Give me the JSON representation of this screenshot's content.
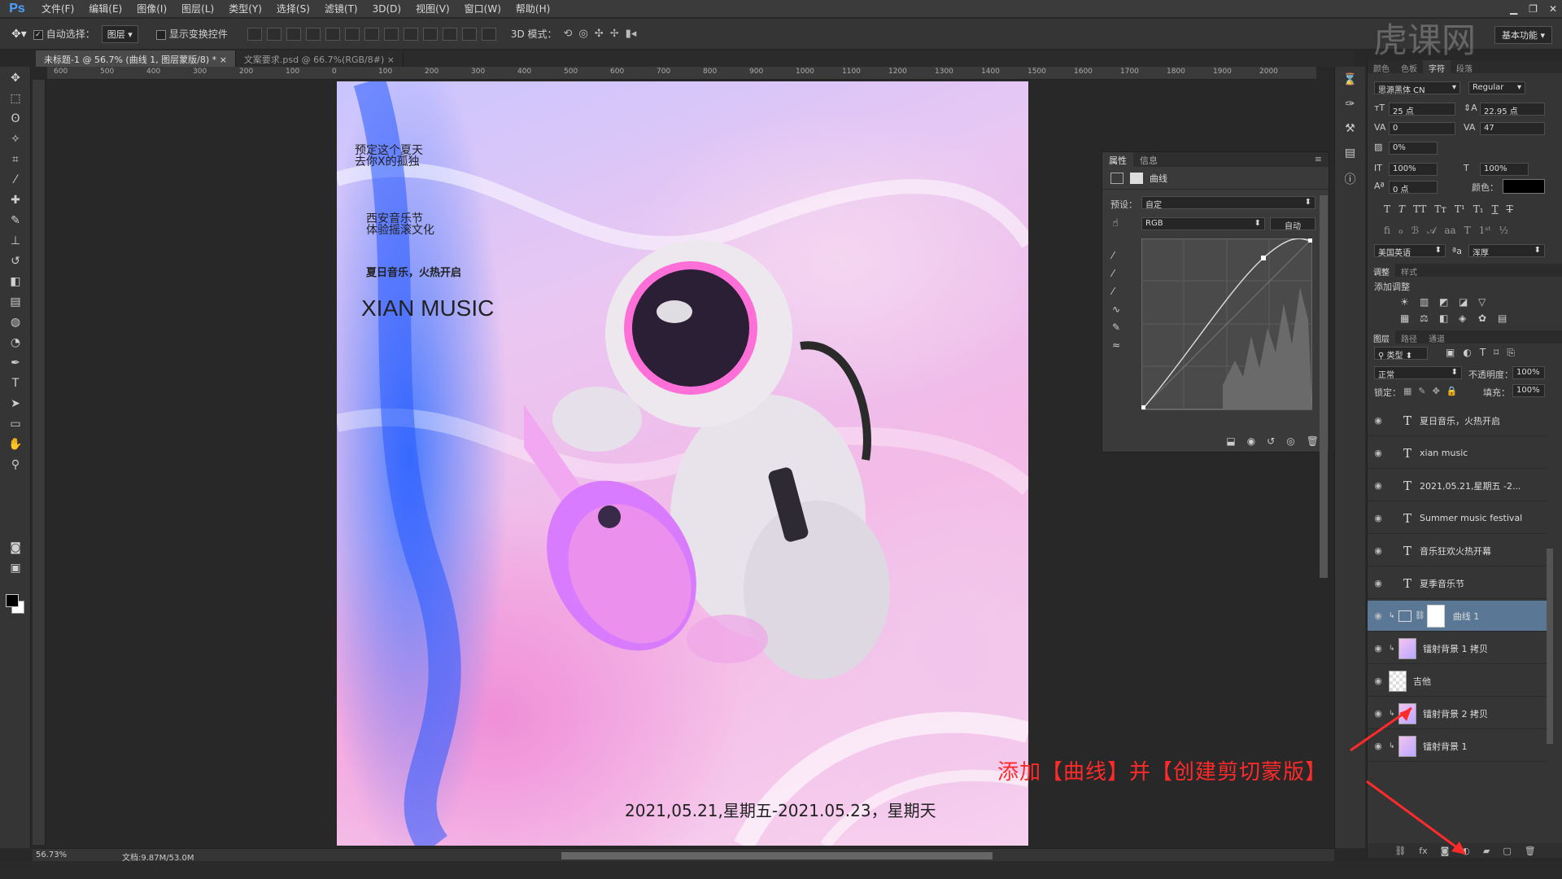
{
  "app": {
    "logo": "Ps"
  },
  "menu": [
    "文件(F)",
    "编辑(E)",
    "图像(I)",
    "图层(L)",
    "类型(Y)",
    "选择(S)",
    "滤镜(T)",
    "3D(D)",
    "视图(V)",
    "窗口(W)",
    "帮助(H)"
  ],
  "options": {
    "auto_select": "自动选择：",
    "auto_select_value": "图层",
    "show_transform": "显示变换控件",
    "mode3d": "3D 模式：",
    "workspace": "基本功能"
  },
  "tabs": [
    {
      "label": "未标题-1 @ 56.7% (曲线 1, 图层蒙版/8) *"
    },
    {
      "label": "文案要求.psd @ 66.7%(RGB/8#)"
    }
  ],
  "ruler_ticks": [
    "600",
    "500",
    "400",
    "300",
    "200",
    "100",
    "0",
    "100",
    "200",
    "300",
    "400",
    "500",
    "600",
    "700",
    "800",
    "900",
    "1000",
    "1100",
    "1200",
    "1300",
    "1400",
    "1500",
    "1600",
    "1700",
    "1800",
    "1900",
    "2000"
  ],
  "poster": {
    "line1": "预定这个夏天",
    "line2": "去你X的孤独",
    "line3": "西安音乐节",
    "line4": "体验摇滚文化",
    "line5": "夏日音乐，火热开启",
    "headline": "XIAN MUSIC",
    "date": "2021,05.21,星期五-2021.05.23，星期天"
  },
  "properties": {
    "tab_props": "属性",
    "tab_info": "信息",
    "title": "曲线",
    "preset_label": "预设：",
    "preset_value": "自定",
    "channel": "RGB",
    "auto": "自动"
  },
  "right": {
    "tabs1": [
      "颜色",
      "色板",
      "字符",
      "段落"
    ],
    "font_family": "思源黑体 CN",
    "font_style": "Regular",
    "font_size": "25 点",
    "leading": "22.95 点",
    "tracking_va": "0",
    "tracking": "47",
    "scale_pct": "0%",
    "vscale": "100%",
    "hscale": "100%",
    "baseline": "0 点",
    "color_label": "颜色：",
    "language": "美国英语",
    "aa_label": "a",
    "aa_value": "浑厚",
    "tabs2": [
      "调整",
      "样式"
    ],
    "add_adjust": "添加调整",
    "tabs3": [
      "图层",
      "路径",
      "通道"
    ],
    "filter": "类型",
    "blend": "正常",
    "opacity_label": "不透明度：",
    "opacity": "100%",
    "lock_label": "锁定：",
    "fill_label": "填充：",
    "fill": "100%"
  },
  "layers": [
    {
      "name": "夏日音乐，火热开启",
      "type": "text",
      "icon": "T"
    },
    {
      "name": "xian music",
      "type": "text",
      "icon": "T"
    },
    {
      "name": "2021,05.21,星期五 -2...",
      "type": "text",
      "icon": "T"
    },
    {
      "name": "Summer music festival",
      "type": "text",
      "icon": "T"
    },
    {
      "name": "音乐狂欢火热开幕",
      "type": "text",
      "icon": "T"
    },
    {
      "name": "夏季音乐节",
      "type": "text",
      "icon": "T"
    },
    {
      "name": "曲线 1",
      "type": "adjust",
      "icon": ""
    },
    {
      "name": "镭射背景 1 拷贝",
      "type": "image",
      "icon": ""
    },
    {
      "name": "吉他",
      "type": "image",
      "icon": ""
    },
    {
      "name": "镭射背景 2 拷贝",
      "type": "image",
      "icon": ""
    },
    {
      "name": "镭射背景 1",
      "type": "image",
      "icon": ""
    }
  ],
  "status": {
    "zoom": "56.73%",
    "doc": "文档:9.87M/53.0M"
  },
  "annotation": "添加【曲线】并【创建剪切蒙版】",
  "watermark": "虎课网",
  "colors": {
    "accent": "#4aa3ff",
    "annotation": "#ff2a2a",
    "selected_layer": "#5a7796"
  }
}
